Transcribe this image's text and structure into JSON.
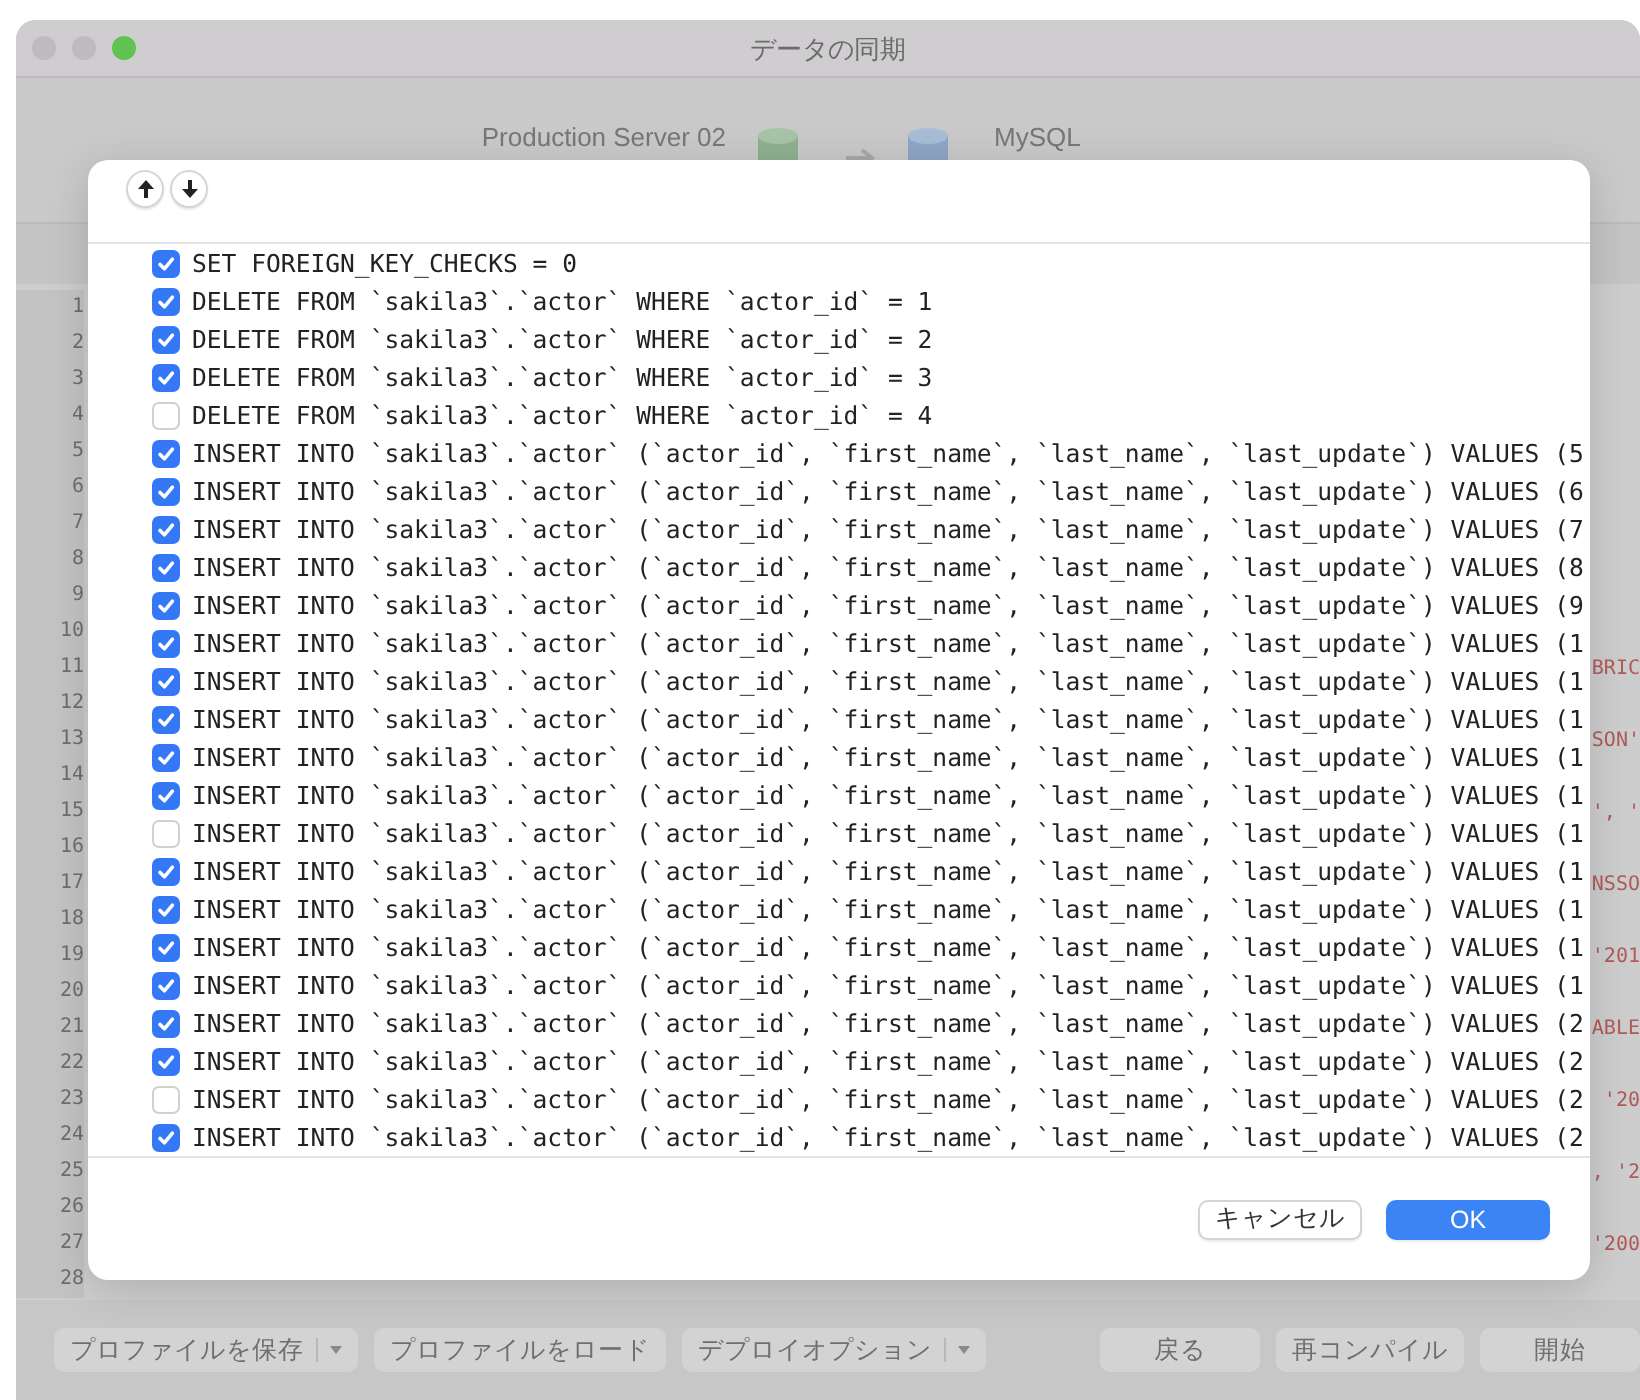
{
  "window": {
    "title": "データの同期"
  },
  "header": {
    "source": "Production Server 02",
    "target": "MySQL"
  },
  "editor": {
    "lines": [
      {
        "number": "1"
      },
      {
        "number": "2"
      },
      {
        "number": "3"
      },
      {
        "number": "4"
      },
      {
        "number": "5"
      },
      {
        "number": "6"
      },
      {
        "number": "7"
      },
      {
        "number": "8"
      },
      {
        "number": "9"
      },
      {
        "number": "10"
      },
      {
        "number": "11",
        "text": "BRIC"
      },
      {
        "number": "12"
      },
      {
        "number": "13",
        "text": "SON'"
      },
      {
        "number": "14"
      },
      {
        "number": "15",
        "text": "', '"
      },
      {
        "number": "16"
      },
      {
        "number": "17",
        "text": "NSSO"
      },
      {
        "number": "18"
      },
      {
        "number": "19",
        "text": "'201"
      },
      {
        "number": "20"
      },
      {
        "number": "21",
        "text": "ABLE"
      },
      {
        "number": "22"
      },
      {
        "number": "23",
        "text": " '20"
      },
      {
        "number": "24"
      },
      {
        "number": "25",
        "text": ", '2"
      },
      {
        "number": "26"
      },
      {
        "number": "27",
        "text": "'200"
      },
      {
        "number": "28"
      }
    ]
  },
  "dialog": {
    "statements": [
      {
        "text": "SET FOREIGN_KEY_CHECKS = 0",
        "checked": true
      },
      {
        "text": "DELETE FROM `sakila3`.`actor` WHERE `actor_id` = 1",
        "checked": true
      },
      {
        "text": "DELETE FROM `sakila3`.`actor` WHERE `actor_id` = 2",
        "checked": true
      },
      {
        "text": "DELETE FROM `sakila3`.`actor` WHERE `actor_id` = 3",
        "checked": true
      },
      {
        "text": "DELETE FROM `sakila3`.`actor` WHERE `actor_id` = 4",
        "checked": false
      },
      {
        "text": "INSERT INTO `sakila3`.`actor` (`actor_id`, `first_name`, `last_name`, `last_update`) VALUES (5",
        "checked": true
      },
      {
        "text": "INSERT INTO `sakila3`.`actor` (`actor_id`, `first_name`, `last_name`, `last_update`) VALUES (6",
        "checked": true
      },
      {
        "text": "INSERT INTO `sakila3`.`actor` (`actor_id`, `first_name`, `last_name`, `last_update`) VALUES (7",
        "checked": true
      },
      {
        "text": "INSERT INTO `sakila3`.`actor` (`actor_id`, `first_name`, `last_name`, `last_update`) VALUES (8",
        "checked": true
      },
      {
        "text": "INSERT INTO `sakila3`.`actor` (`actor_id`, `first_name`, `last_name`, `last_update`) VALUES (9",
        "checked": true
      },
      {
        "text": "INSERT INTO `sakila3`.`actor` (`actor_id`, `first_name`, `last_name`, `last_update`) VALUES (1",
        "checked": true
      },
      {
        "text": "INSERT INTO `sakila3`.`actor` (`actor_id`, `first_name`, `last_name`, `last_update`) VALUES (1",
        "checked": true
      },
      {
        "text": "INSERT INTO `sakila3`.`actor` (`actor_id`, `first_name`, `last_name`, `last_update`) VALUES (1",
        "checked": true
      },
      {
        "text": "INSERT INTO `sakila3`.`actor` (`actor_id`, `first_name`, `last_name`, `last_update`) VALUES (1",
        "checked": true
      },
      {
        "text": "INSERT INTO `sakila3`.`actor` (`actor_id`, `first_name`, `last_name`, `last_update`) VALUES (1",
        "checked": true
      },
      {
        "text": "INSERT INTO `sakila3`.`actor` (`actor_id`, `first_name`, `last_name`, `last_update`) VALUES (1",
        "checked": false
      },
      {
        "text": "INSERT INTO `sakila3`.`actor` (`actor_id`, `first_name`, `last_name`, `last_update`) VALUES (1",
        "checked": true
      },
      {
        "text": "INSERT INTO `sakila3`.`actor` (`actor_id`, `first_name`, `last_name`, `last_update`) VALUES (1",
        "checked": true
      },
      {
        "text": "INSERT INTO `sakila3`.`actor` (`actor_id`, `first_name`, `last_name`, `last_update`) VALUES (1",
        "checked": true
      },
      {
        "text": "INSERT INTO `sakila3`.`actor` (`actor_id`, `first_name`, `last_name`, `last_update`) VALUES (1",
        "checked": true
      },
      {
        "text": "INSERT INTO `sakila3`.`actor` (`actor_id`, `first_name`, `last_name`, `last_update`) VALUES (2",
        "checked": true
      },
      {
        "text": "INSERT INTO `sakila3`.`actor` (`actor_id`, `first_name`, `last_name`, `last_update`) VALUES (2",
        "checked": true
      },
      {
        "text": "INSERT INTO `sakila3`.`actor` (`actor_id`, `first_name`, `last_name`, `last_update`) VALUES (2",
        "checked": false
      },
      {
        "text": "INSERT INTO `sakila3`.`actor` (`actor_id`, `first_name`, `last_name`, `last_update`) VALUES (2",
        "checked": true
      }
    ],
    "buttons": [
      {
        "label": "キャンセル",
        "kind": "default"
      },
      {
        "label": "OK",
        "kind": "primary"
      }
    ]
  },
  "toolbar": {
    "left": [
      {
        "label": "プロファイルを保存",
        "dropdown": true
      },
      {
        "label": "プロファイルをロード",
        "dropdown": false
      },
      {
        "label": "デプロイオプション",
        "dropdown": true
      }
    ],
    "right": [
      {
        "label": "戻る",
        "dropdown": false
      },
      {
        "label": "再コンパイル",
        "dropdown": false
      },
      {
        "label": "開始",
        "dropdown": false
      }
    ]
  }
}
